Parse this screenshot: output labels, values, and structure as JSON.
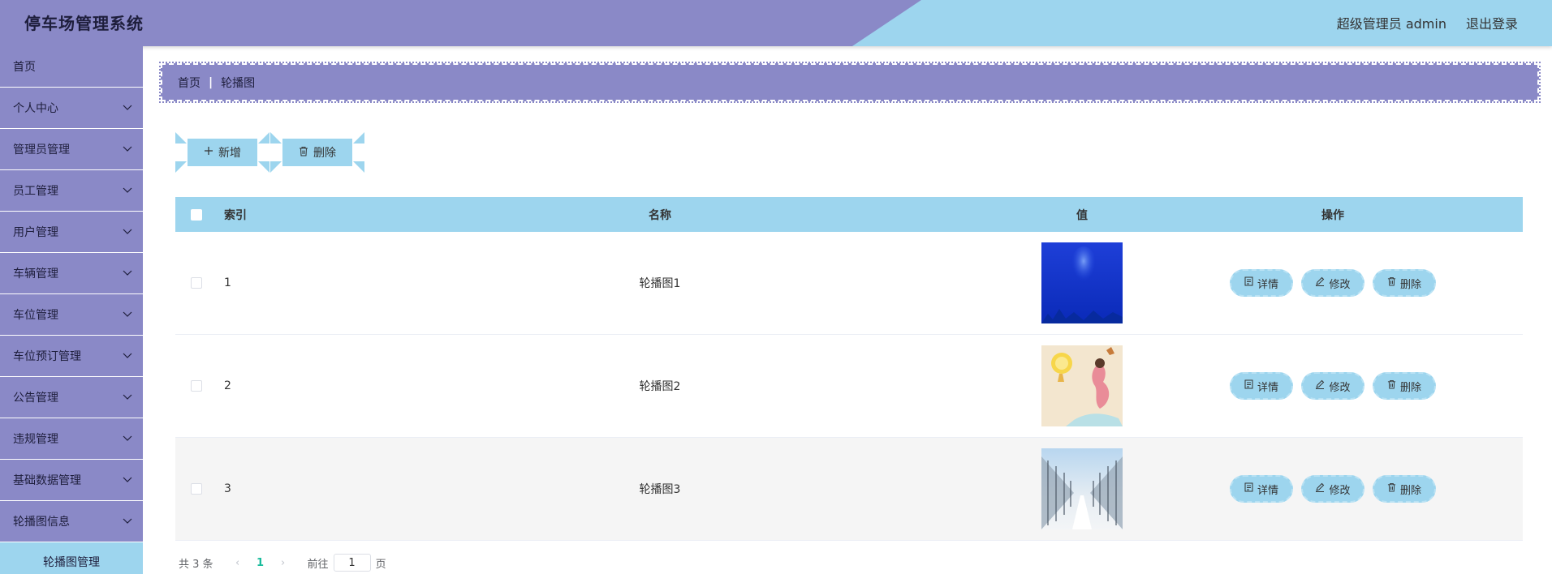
{
  "header": {
    "title": "停车场管理系统",
    "user": "超级管理员 admin",
    "logout": "退出登录"
  },
  "sidebar": {
    "items": [
      {
        "label": "首页",
        "icon": "none"
      },
      {
        "label": "个人中心",
        "icon": "chevron-down-icon"
      },
      {
        "label": "管理员管理",
        "icon": "chevron-down-icon"
      },
      {
        "label": "员工管理",
        "icon": "chevron-down-icon"
      },
      {
        "label": "用户管理",
        "icon": "chevron-down-icon"
      },
      {
        "label": "车辆管理",
        "icon": "chevron-down-icon"
      },
      {
        "label": "车位管理",
        "icon": "chevron-down-icon"
      },
      {
        "label": "车位预订管理",
        "icon": "chevron-down-icon"
      },
      {
        "label": "公告管理",
        "icon": "chevron-down-icon"
      },
      {
        "label": "违规管理",
        "icon": "chevron-down-icon"
      },
      {
        "label": "基础数据管理",
        "icon": "chevron-down-icon"
      },
      {
        "label": "轮播图信息",
        "icon": "chevron-down-icon"
      }
    ],
    "active_sub": "轮播图管理"
  },
  "breadcrumb": {
    "home": "首页",
    "current": "轮播图"
  },
  "toolbar": {
    "add_label": "新增",
    "delete_label": "删除"
  },
  "table": {
    "columns": [
      "索引",
      "名称",
      "值",
      "操作"
    ],
    "rows": [
      {
        "index": "1",
        "name": "轮播图1",
        "image": "blue-abstract-image"
      },
      {
        "index": "2",
        "name": "轮播图2",
        "image": "illustration-image"
      },
      {
        "index": "3",
        "name": "轮播图3",
        "image": "snowy-trees-image"
      }
    ],
    "actions": {
      "detail": "详情",
      "edit": "修改",
      "delete": "删除"
    }
  },
  "pagination": {
    "total": "共 3 条",
    "current_page": "1",
    "goto_label": "前往",
    "goto_value": "1",
    "page_suffix": "页"
  },
  "colors": {
    "primary": "#8a89c7",
    "accent": "#9dd5ee",
    "page_active": "#1abc9c"
  }
}
